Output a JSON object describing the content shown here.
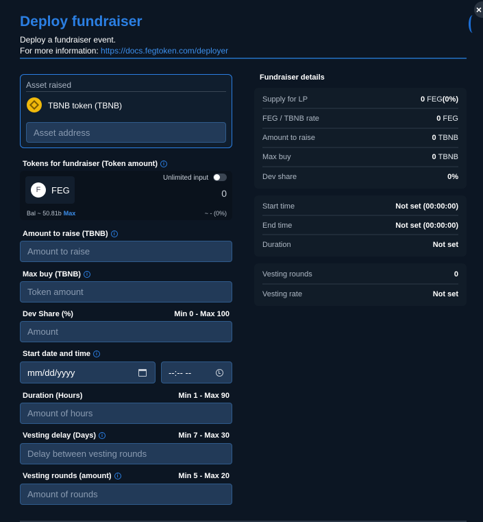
{
  "header": {
    "title": "Deploy fundraiser",
    "subtitle": "Deploy a fundraiser event.",
    "info_prefix": "For more information:",
    "info_link": "https://docs.fegtoken.com/deployer",
    "close_label": "×"
  },
  "asset": {
    "label": "Asset raised",
    "token_name": "TBNB token (TBNB)",
    "address_placeholder": "Asset address"
  },
  "tokens": {
    "label": "Tokens for fundraiser (Token amount)",
    "symbol": "FEG",
    "logo_letter": "F",
    "unlimited_label": "Unlimited input",
    "amount": "0",
    "balance": "Bal ~ 50.81b",
    "max_label": "Max",
    "usd_value": "~ - (0%)"
  },
  "fields": {
    "amount_to_raise": {
      "label": "Amount to raise (TBNB)",
      "placeholder": "Amount to raise"
    },
    "max_buy": {
      "label": "Max buy (TBNB)",
      "placeholder": "Token amount"
    },
    "dev_share": {
      "label": "Dev Share (%)",
      "range": "Min 0 - Max 100",
      "placeholder": "Amount"
    },
    "start": {
      "label": "Start date and time",
      "date_value": "mm/dd/yyyy",
      "time_value": "--:-- --"
    },
    "duration": {
      "label": "Duration (Hours)",
      "range": "Min 1 - Max 90",
      "placeholder": "Amount of hours"
    },
    "vesting_delay": {
      "label": "Vesting delay (Days)",
      "range": "Min 7 - Max 30",
      "placeholder": "Delay between vesting rounds"
    },
    "vesting_rounds": {
      "label": "Vesting rounds (amount)",
      "range": "Min 5 - Max 20",
      "placeholder": "Amount of rounds"
    }
  },
  "details": {
    "title": "Fundraiser details",
    "card1": [
      {
        "key": "Supply for LP",
        "value": "0",
        "unit": "FEG",
        "extra": "(0%)"
      },
      {
        "key": "FEG / TBNB rate",
        "value": "0",
        "unit": "FEG",
        "extra": ""
      },
      {
        "key": "Amount to raise",
        "value": "0",
        "unit": "TBNB",
        "extra": ""
      },
      {
        "key": "Max buy",
        "value": "0",
        "unit": "TBNB",
        "extra": ""
      },
      {
        "key": "Dev share",
        "value": "0%",
        "unit": "",
        "extra": ""
      }
    ],
    "card2": [
      {
        "key": "Start time",
        "value": "Not set (00:00:00)"
      },
      {
        "key": "End time",
        "value": "Not set (00:00:00)"
      },
      {
        "key": "Duration",
        "value": "Not set"
      }
    ],
    "card3": [
      {
        "key": "Vesting rounds",
        "value": "0"
      },
      {
        "key": "Vesting rate",
        "value": "Not set"
      }
    ]
  },
  "colors": {
    "background": "#0c1623",
    "accent": "#2b7fe3",
    "input_bg": "#223a58",
    "card_bg": "#111c28"
  }
}
